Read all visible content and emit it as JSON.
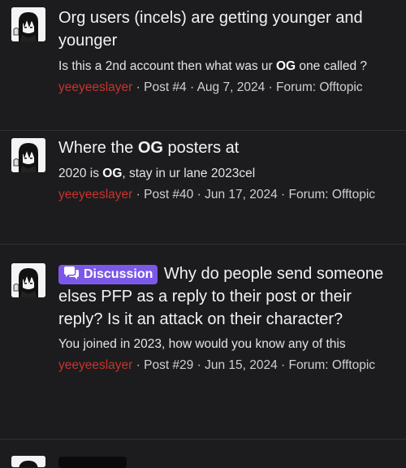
{
  "results": [
    {
      "title_parts": [
        "Org users (incels) are getting younger and younger"
      ],
      "snippet": {
        "before": "Is this a 2nd account then what was ur ",
        "bold": "OG",
        "after": " one called ?"
      },
      "author": "yeeyeeslayer",
      "post": "Post #4",
      "date": "Aug 7, 2024",
      "forum": "Forum: Offtopic"
    },
    {
      "title": {
        "before": "Where the ",
        "bold": "OG",
        "after": " posters at"
      },
      "snippet": {
        "before": "2020 is ",
        "bold": "OG",
        "after": ", stay in ur lane 2023cel"
      },
      "author": "yeeyeeslayer",
      "post": "Post #40",
      "date": "Jun 17, 2024",
      "forum": "Forum: Offtopic"
    },
    {
      "badge": "Discussion",
      "title": "Why do people send someone elses PFP as a reply to their post or their reply? Is it an attack on their character?",
      "snippet": "You joined in 2023, how would you know any of this",
      "author": "yeeyeeslayer",
      "post": "Post #29",
      "date": "Jun 15, 2024",
      "forum": "Forum: Offtopic"
    }
  ],
  "separator": " · ",
  "icons": {
    "avatar": "anime-girl-avatar-icon",
    "badge": "chat-bubbles-icon"
  },
  "colors": {
    "background": "#1c1c1e",
    "author": "#c8332c",
    "badge": "#7b58e8",
    "divider": "#303033"
  }
}
